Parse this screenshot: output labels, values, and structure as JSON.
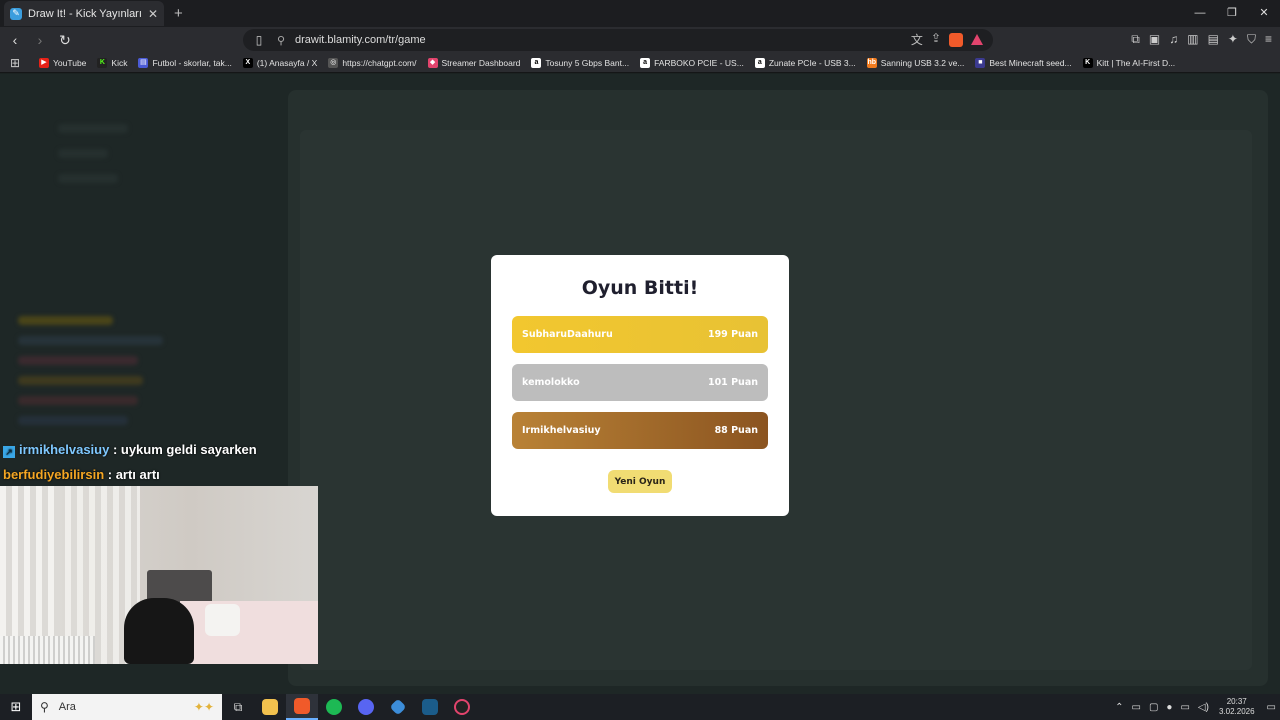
{
  "browser": {
    "tab_title": "Draw It! - Kick Yayınları İçin Çizim",
    "url": "drawit.blamity.com/tr/game",
    "bookmarks": [
      {
        "label": "YouTube",
        "color": "#e62117"
      },
      {
        "label": "Kick",
        "color": "#53fc18"
      },
      {
        "label": "Futbol - skorlar, tak...",
        "color": "#4b5bd6"
      },
      {
        "label": "(1) Anasayfa / X",
        "color": "#000000"
      },
      {
        "label": "https://chatgpt.com/",
        "color": "#555555"
      },
      {
        "label": "Streamer Dashboard",
        "color": "#e2446d"
      },
      {
        "label": "Tosuny 5 Gbps Bant...",
        "color": "#ffffff"
      },
      {
        "label": "FARBOKO PCIE - US...",
        "color": "#ffffff"
      },
      {
        "label": "Zunate PCIe - USB 3...",
        "color": "#ffffff"
      },
      {
        "label": "Sanning USB 3.2 ve...",
        "color": "#f07b1f"
      },
      {
        "label": "Best Minecraft seed...",
        "color": "#3b3a8f"
      },
      {
        "label": "Kitt | The AI-First D...",
        "color": "#000000"
      }
    ]
  },
  "chat": [
    {
      "user": "irmikhelvasiuy",
      "user_color": "#7fc8ff",
      "message": " : uykum geldi sayarken",
      "badge": true
    },
    {
      "user": "berfudiyebilirsin",
      "user_color": "#f5a623",
      "message": " : artı artı",
      "badge": false
    }
  ],
  "modal": {
    "title": "Oyun Bitti!",
    "players": [
      {
        "name": "SubharuDaahuru",
        "score": "199 Puan"
      },
      {
        "name": "kemolokko",
        "score": "101 Puan"
      },
      {
        "name": "Irmikhelvasiuy",
        "score": "88 Puan"
      }
    ],
    "new_game_label": "Yeni Oyun"
  },
  "taskbar": {
    "search_placeholder": "Ara",
    "time": "20:37",
    "date": "3.02.2026"
  }
}
